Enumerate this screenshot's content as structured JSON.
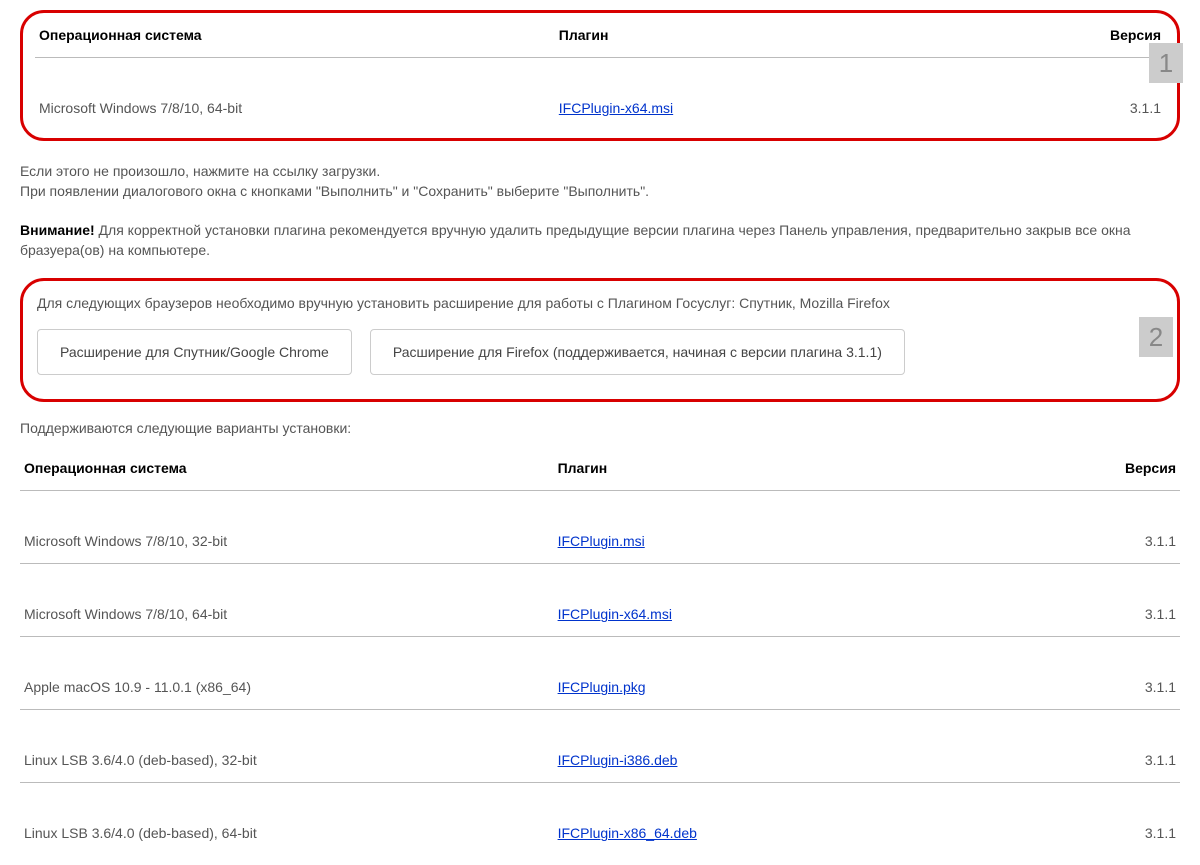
{
  "table1": {
    "headers": {
      "os": "Операционная система",
      "plugin": "Плагин",
      "version": "Версия"
    },
    "rows": [
      {
        "os": "Microsoft Windows 7/8/10, 64-bit",
        "plugin": "IFCPlugin-x64.msi",
        "version": "3.1.1"
      }
    ]
  },
  "note1": "Если этого не произошло, нажмите на ссылку загрузки.",
  "note2": "При появлении диалогового окна с кнопками \"Выполнить\" и \"Сохранить\" выберите \"Выполнить\".",
  "warning_label": "Внимание!",
  "warning_text": " Для корректной установки плагина рекомендуется вручную удалить предыдущие версии плагина через Панель управления, предварительно закрыв все окна бразуера(ов) на компьютере.",
  "section2_intro": "Для следующих браузеров необходимо вручную установить расширение для работы с Плагином Госуслуг: Спутник, Mozilla Firefox",
  "btn_chrome": "Расширение для Спутник/Google Chrome",
  "btn_firefox": "Расширение для Firefox (поддерживается, начиная с версии плагина 3.1.1)",
  "supported_heading": "Поддерживаются следующие варианты установки:",
  "table2": {
    "headers": {
      "os": "Операционная система",
      "plugin": "Плагин",
      "version": "Версия"
    },
    "rows": [
      {
        "os": "Microsoft Windows 7/8/10, 32-bit",
        "plugin": "IFCPlugin.msi",
        "version": "3.1.1"
      },
      {
        "os": "Microsoft Windows 7/8/10, 64-bit",
        "plugin": "IFCPlugin-x64.msi",
        "version": "3.1.1"
      },
      {
        "os": "Apple macOS 10.9 - 11.0.1 (x86_64)",
        "plugin": "IFCPlugin.pkg",
        "version": "3.1.1"
      },
      {
        "os": "Linux LSB 3.6/4.0 (deb-based), 32-bit",
        "plugin": "IFCPlugin-i386.deb",
        "version": "3.1.1"
      },
      {
        "os": "Linux LSB 3.6/4.0 (deb-based), 64-bit",
        "plugin": "IFCPlugin-x86_64.deb",
        "version": "3.1.1"
      }
    ]
  },
  "annotations": {
    "one": "1",
    "two": "2"
  }
}
